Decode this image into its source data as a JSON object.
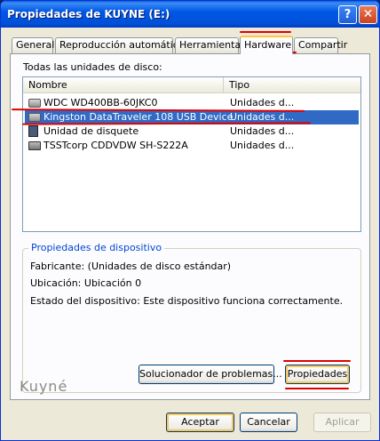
{
  "window": {
    "title": "Propiedades de KUYNE (E:)"
  },
  "title_buttons": {
    "help": "?",
    "close": "✕"
  },
  "tabs": [
    {
      "label": "General"
    },
    {
      "label": "Reproducción automática"
    },
    {
      "label": "Herramientas"
    },
    {
      "label": "Hardware",
      "active": true
    },
    {
      "label": "Compartir"
    }
  ],
  "disks_label": "Todas las unidades de disco:",
  "list": {
    "columns": [
      "Nombre",
      "Tipo"
    ],
    "rows": [
      {
        "name": "WDC WD400BB-60JKC0",
        "type": "Unidades d...",
        "icon": "hard-drive-icon"
      },
      {
        "name": "Kingston DataTraveler 108 USB Device",
        "type": "Unidades d...",
        "icon": "usb-drive-icon",
        "selected": true
      },
      {
        "name": "Unidad de disquete",
        "type": "Unidades d...",
        "icon": "floppy-icon"
      },
      {
        "name": "TSSTcorp CDDVDW SH-S222A",
        "type": "Unidades d...",
        "icon": "cd-drive-icon"
      }
    ]
  },
  "device_props": {
    "legend": "Propiedades de dispositivo",
    "manufacturer": "Fabricante: (Unidades de disco estándar)",
    "location": "Ubicación: Ubicación 0",
    "status": "Estado del dispositivo: Este dispositivo funciona correctamente."
  },
  "buttons": {
    "troubleshoot": "Solucionador de problemas...",
    "properties": "Propiedades",
    "ok": "Aceptar",
    "cancel": "Cancelar",
    "apply": "Aplicar"
  },
  "watermark": "Kuyné",
  "colors": {
    "accent": "#316ac5",
    "annotation": "#e00000",
    "legend": "#0046d5"
  }
}
